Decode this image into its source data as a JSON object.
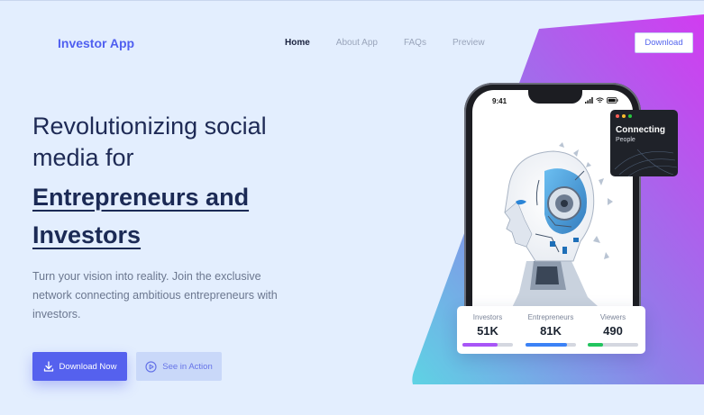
{
  "header": {
    "brand": "Investor App",
    "nav": [
      {
        "label": "Home",
        "active": true
      },
      {
        "label": "About App",
        "active": false
      },
      {
        "label": "FAQs",
        "active": false
      },
      {
        "label": "Preview",
        "active": false
      }
    ],
    "download_label": "Download"
  },
  "hero": {
    "title_line1": "Revolutionizing social",
    "title_line2": "media for",
    "accent_line1": "Entrepreneurs and",
    "accent_line2": "Investors",
    "description": "Turn your vision into reality. Join the exclusive network connecting ambitious entrepreneurs with investors.",
    "primary_button": "Download Now",
    "secondary_button": "See in Action"
  },
  "phone": {
    "time": "9:41"
  },
  "card": {
    "title": "Connecting",
    "subtitle": "People",
    "dot_colors": [
      "#ff5f57",
      "#febc2e",
      "#28c840"
    ]
  },
  "stats": [
    {
      "label": "Investors",
      "value": "51K",
      "fill": 0.7,
      "color": "#a855f7"
    },
    {
      "label": "Entrepreneurs",
      "value": "81K",
      "fill": 0.82,
      "color": "#3b82f6"
    },
    {
      "label": "Viewers",
      "value": "490",
      "fill": 0.3,
      "color": "#22c55e"
    }
  ],
  "colors": {
    "brand": "#4f5ff0",
    "gradient_start": "#5fd0e6",
    "gradient_end": "#c940ee"
  }
}
